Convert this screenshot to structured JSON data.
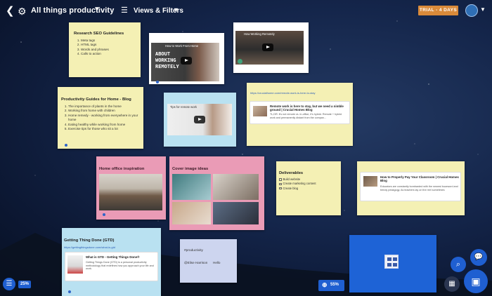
{
  "header": {
    "back_icon": "back-chevron-icon",
    "settings_icon": "gear-icon",
    "board_title": "All things productivity",
    "views_label": "Views & Filters",
    "trial_badge": "TRIAL - 4 DAYS"
  },
  "notes": {
    "seo": {
      "title": "Research SEO Guidelines",
      "items": [
        "Meta tags",
        "HTML tags",
        "Words and phrases",
        "Calls to action"
      ]
    },
    "guides": {
      "title": "Productivity Guides for Home - Blog",
      "items": [
        "The importance of plants in the home",
        "Working from home with children",
        "Home remedy - working from everywhere in your home",
        "Eating healthy while working from home",
        "Exercise tips for those who sit a lot"
      ]
    },
    "video1": {
      "title": "How to Work From Home",
      "caption_lines": [
        "ABOUT",
        "WORKING",
        "REMOTELY"
      ]
    },
    "video2": {
      "title": "How Working Remotely"
    },
    "video3": {
      "title": "Tips for remote work"
    },
    "remote_link": {
      "url": "https://crucialhome.com/remote-work-is-here-to-stay",
      "title": "Remote work is here to stay, but we need a nimble ground | Crucial Homes Blog",
      "text": "TL;DR: it's not remote vs. in-office, it's hybrid. Remote + hybrid work and permanently distant from the compan..."
    },
    "home_office": {
      "title": "Home office inspiration"
    },
    "cover_images": {
      "title": "Cover image ideas"
    },
    "deliverables": {
      "title": "Deliverables",
      "items": [
        "Build website",
        "Create marketing content",
        "Create blog"
      ]
    },
    "classroom": {
      "title": "How to Properly Pay Your Classroom | Crucial Homes Blog",
      "text": "Educators are constantly bombarded with the newest buzzword and trendy pedagogy. As teachers lay on the reel sometimes"
    },
    "gtd": {
      "title": "Getting Thing Done (GTD)",
      "url": "https://gettingthingsdone.com/what-is-gtd",
      "preview_title": "What is GTD - Getting Things Done®",
      "preview_text": "Getting Things Done (GTD) is a personal productivity methodology that redefines how you approach your life and work."
    },
    "hashtag": {
      "tag": "#productivity",
      "mention": "@Elise Harrison",
      "reply": "Hello"
    }
  },
  "controls": {
    "list_zoom": "25%",
    "board_zoom": "55%",
    "search_icon": "search-icon",
    "chat_icon": "chat-bubbles-icon",
    "map_icon": "map-icon",
    "note_icon": "new-note-icon"
  },
  "colors": {
    "sticky_yellow": "#f4f0b4",
    "sticky_blue": "#b9e1f1",
    "sticky_pink": "#ea9bb6",
    "sticky_lavender": "#cdd5ef",
    "accent_blue": "#1f5fd1",
    "trial_orange": "#d98a3a"
  }
}
